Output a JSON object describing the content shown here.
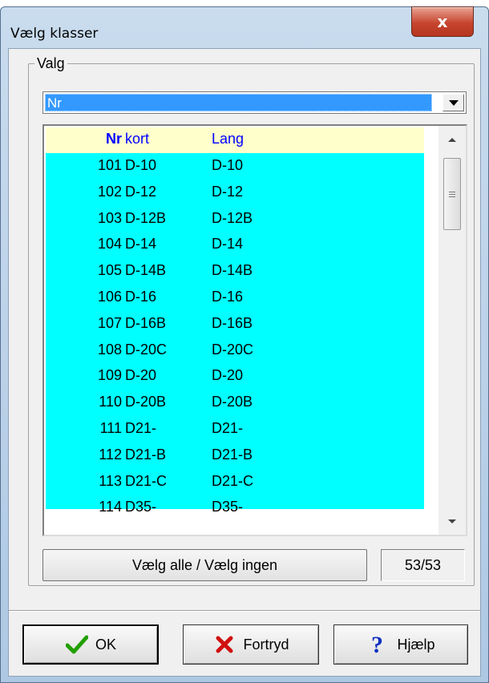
{
  "window": {
    "title": "Vælg klasser",
    "close_label": "x"
  },
  "group": {
    "label": "Valg"
  },
  "combo": {
    "value": "Nr"
  },
  "list": {
    "headers": {
      "nr": "Nr",
      "kort": "kort",
      "lang": "Lang"
    },
    "rows": [
      {
        "nr": "101",
        "kort": "D-10",
        "lang": "D-10"
      },
      {
        "nr": "102",
        "kort": "D-12",
        "lang": "D-12"
      },
      {
        "nr": "103",
        "kort": "D-12B",
        "lang": "D-12B"
      },
      {
        "nr": "104",
        "kort": "D-14",
        "lang": "D-14"
      },
      {
        "nr": "105",
        "kort": "D-14B",
        "lang": "D-14B"
      },
      {
        "nr": "106",
        "kort": "D-16",
        "lang": "D-16"
      },
      {
        "nr": "107",
        "kort": "D-16B",
        "lang": "D-16B"
      },
      {
        "nr": "108",
        "kort": "D-20C",
        "lang": "D-20C"
      },
      {
        "nr": "109",
        "kort": "D-20",
        "lang": "D-20"
      },
      {
        "nr": "110",
        "kort": "D-20B",
        "lang": "D-20B"
      },
      {
        "nr": "111",
        "kort": "D21-",
        "lang": "D21-"
      },
      {
        "nr": "112",
        "kort": "D21-B",
        "lang": "D21-B"
      },
      {
        "nr": "113",
        "kort": "D21-C",
        "lang": "D21-C"
      },
      {
        "nr": "114",
        "kort": "D35-",
        "lang": "D35-"
      }
    ]
  },
  "select_all_label": "Vælg alle / Vælg ingen",
  "count": "53/53",
  "buttons": {
    "ok": "OK",
    "cancel": "Fortryd",
    "help": "Hjælp"
  },
  "icons": {
    "ok": "checkmark-icon",
    "cancel": "x-icon",
    "help": "question-mark-icon"
  },
  "colors": {
    "list_background": "#00ffff",
    "header_background": "#ffffcc",
    "header_text": "#0000ff",
    "selection": "#3399ff",
    "ok_check": "#22a000",
    "cancel_x": "#d01010",
    "help_q": "#1030c0"
  }
}
